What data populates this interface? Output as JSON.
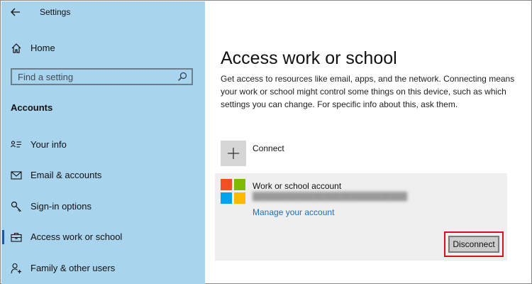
{
  "window": {
    "title": "Settings"
  },
  "sidebar": {
    "home_label": "Home",
    "search": {
      "placeholder": "Find a setting"
    },
    "section_title": "Accounts",
    "items": [
      {
        "label": "Your info",
        "icon": "person-card-icon"
      },
      {
        "label": "Email & accounts",
        "icon": "mail-icon"
      },
      {
        "label": "Sign-in options",
        "icon": "key-icon"
      },
      {
        "label": "Access work or school",
        "icon": "briefcase-icon",
        "selected": true
      },
      {
        "label": "Family & other users",
        "icon": "person-add-icon"
      }
    ]
  },
  "main": {
    "title": "Access work or school",
    "description": "Get access to resources like email, apps, and the network. Connecting means your work or school might control some things on this device, such as which settings you can change. For specific info about this, ask them.",
    "connect_label": "Connect",
    "account": {
      "title": "Work or school account",
      "manage_link": "Manage your account",
      "disconnect_label": "Disconnect"
    }
  },
  "colors": {
    "sidebar_bg": "#a9d4ee",
    "accent": "#1a5aa8",
    "link": "#1f6eb5",
    "highlight": "#d3131f",
    "ms_logo": [
      "#f25022",
      "#7fba00",
      "#00a4ef",
      "#ffb900"
    ]
  }
}
